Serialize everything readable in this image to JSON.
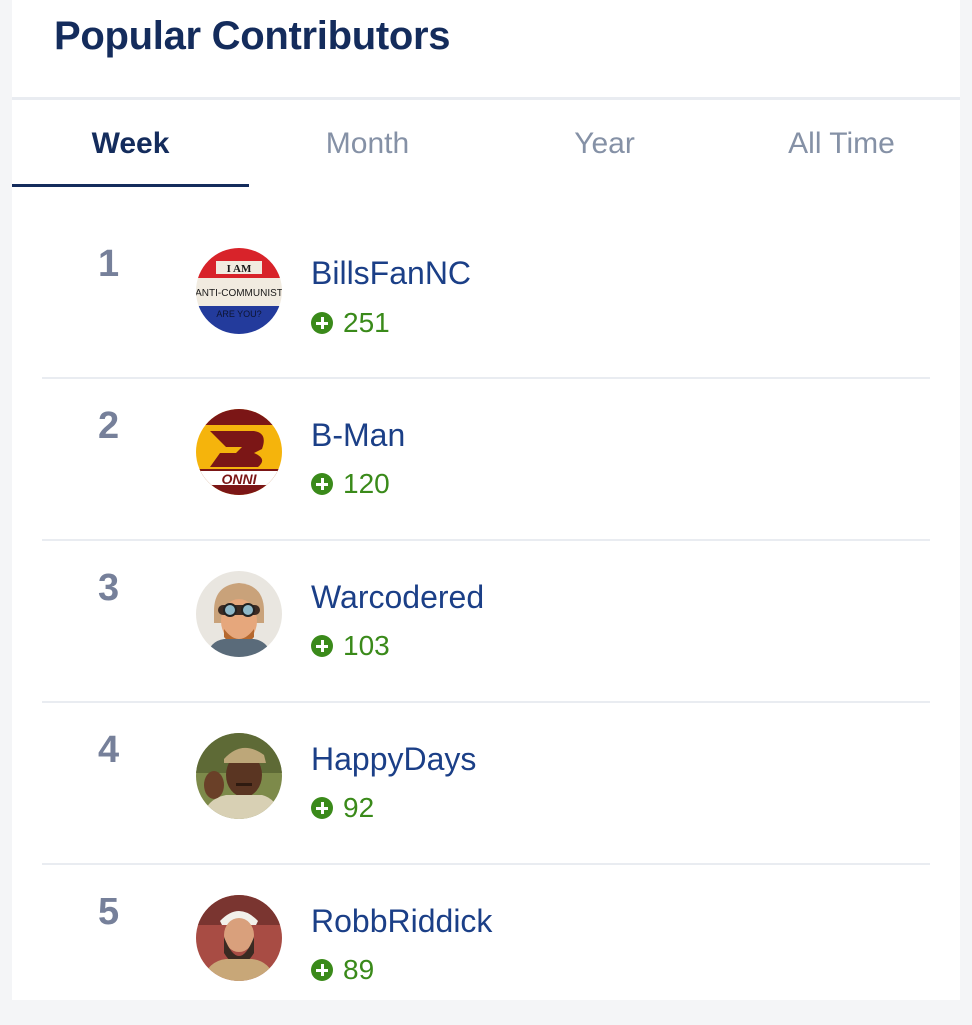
{
  "widget": {
    "title": "Popular Contributors"
  },
  "tabs": [
    {
      "label": "Week",
      "active": true
    },
    {
      "label": "Month",
      "active": false
    },
    {
      "label": "Year",
      "active": false
    },
    {
      "label": "All Time",
      "active": false
    }
  ],
  "contributors": [
    {
      "rank": "1",
      "name": "BillsFanNC",
      "points": "251",
      "avatar": "anti-communist-button-avatar",
      "avatar_text": [
        "I AM",
        "ANTI-COMMUNIST",
        "ARE YOU?"
      ]
    },
    {
      "rank": "2",
      "name": "B-Man",
      "points": "120",
      "avatar": "redskins-logo-avatar",
      "avatar_text": [
        "ONNI"
      ]
    },
    {
      "rank": "3",
      "name": "Warcodered",
      "points": "103",
      "avatar": "aviator-cartoon-avatar"
    },
    {
      "rank": "4",
      "name": "HappyDays",
      "points": "92",
      "avatar": "man-in-cap-avatar"
    },
    {
      "rank": "5",
      "name": "RobbRiddick",
      "points": "89",
      "avatar": "bearded-man-avatar"
    }
  ],
  "colors": {
    "title": "#142c5c",
    "name_link": "#1b3f87",
    "reputation": "#3a8a1a",
    "rank": "#76809a",
    "tab_inactive": "#8591a6"
  }
}
